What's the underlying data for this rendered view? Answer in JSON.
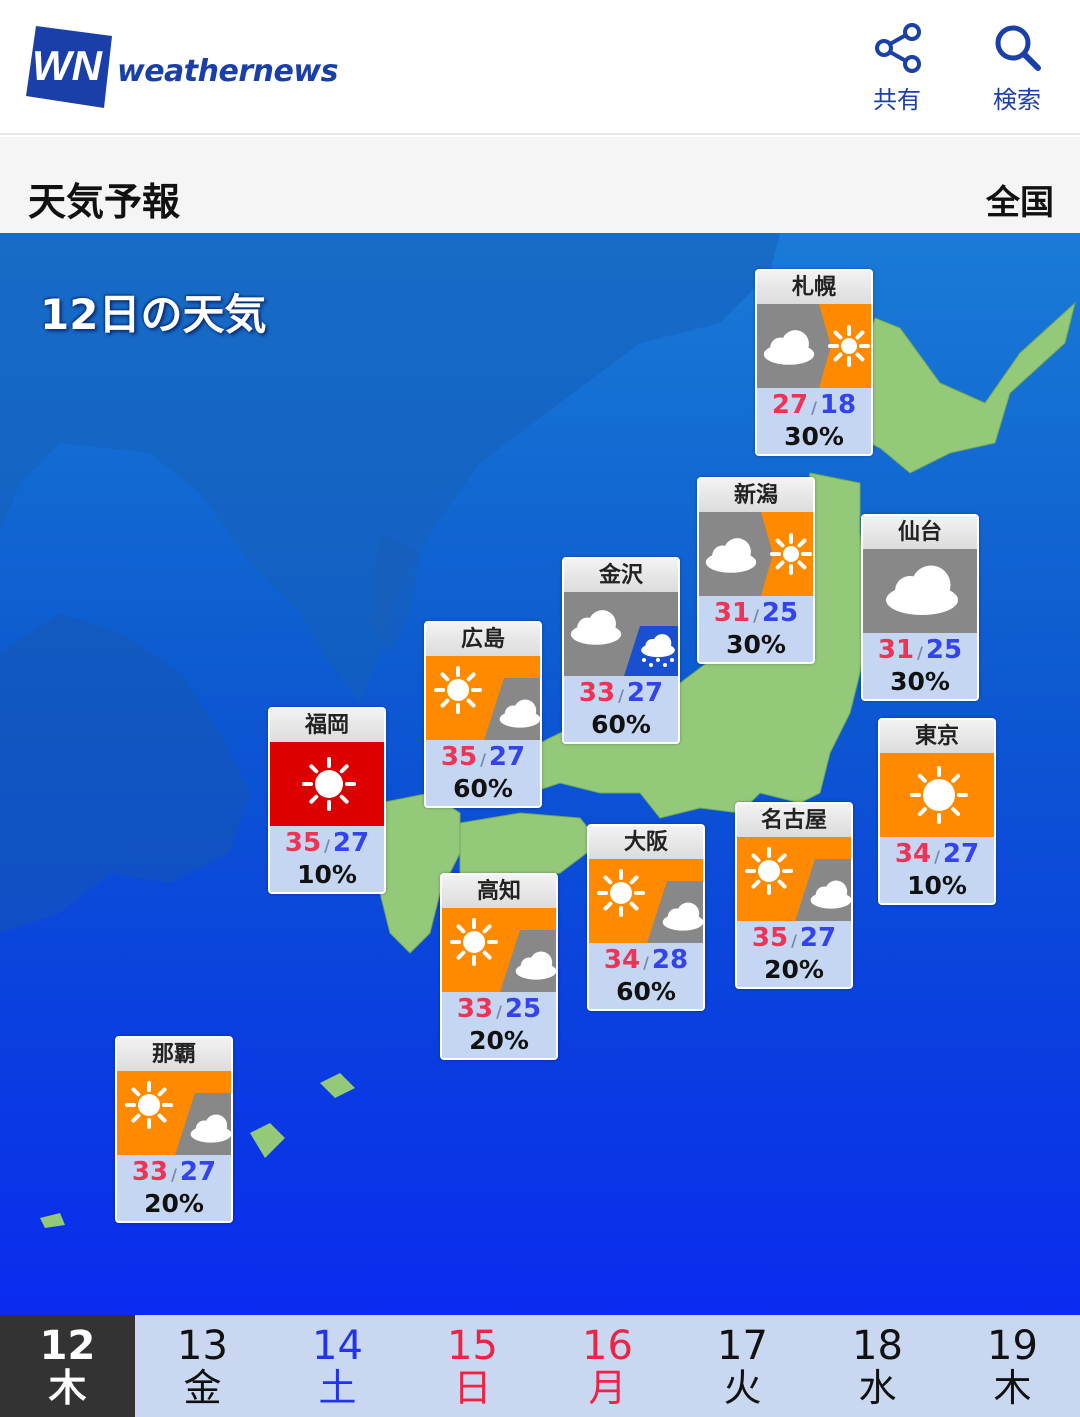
{
  "header": {
    "logo_text": "weathernews",
    "share_label": "共有",
    "search_label": "検索"
  },
  "subheader": {
    "title": "天気予報",
    "region": "全国"
  },
  "map": {
    "title": "12日の天気",
    "cities": [
      {
        "name": "札幌",
        "hi": "27",
        "lo": "18",
        "pop": "30%",
        "weather": "cloudy-then-sunny"
      },
      {
        "name": "新潟",
        "hi": "31",
        "lo": "25",
        "pop": "30%",
        "weather": "cloudy-then-sunny"
      },
      {
        "name": "仙台",
        "hi": "31",
        "lo": "25",
        "pop": "30%",
        "weather": "cloudy"
      },
      {
        "name": "金沢",
        "hi": "33",
        "lo": "27",
        "pop": "60%",
        "weather": "cloudy-with-rain"
      },
      {
        "name": "広島",
        "hi": "35",
        "lo": "27",
        "pop": "60%",
        "weather": "sunny-with-clouds"
      },
      {
        "name": "福岡",
        "hi": "35",
        "lo": "27",
        "pop": "10%",
        "weather": "hot-sunny"
      },
      {
        "name": "東京",
        "hi": "34",
        "lo": "27",
        "pop": "10%",
        "weather": "sunny"
      },
      {
        "name": "名古屋",
        "hi": "35",
        "lo": "27",
        "pop": "20%",
        "weather": "sunny-with-clouds"
      },
      {
        "name": "大阪",
        "hi": "34",
        "lo": "28",
        "pop": "60%",
        "weather": "sunny-with-clouds"
      },
      {
        "name": "高知",
        "hi": "33",
        "lo": "25",
        "pop": "20%",
        "weather": "sunny-with-clouds"
      },
      {
        "name": "那覇",
        "hi": "33",
        "lo": "27",
        "pop": "20%",
        "weather": "sunny-with-clouds"
      }
    ]
  },
  "days": [
    {
      "num": "12",
      "wd": "木",
      "color": "#ffffff",
      "selected": true
    },
    {
      "num": "13",
      "wd": "金",
      "color": "#111111"
    },
    {
      "num": "14",
      "wd": "土",
      "color": "#2233ee"
    },
    {
      "num": "15",
      "wd": "日",
      "color": "#ee2244"
    },
    {
      "num": "16",
      "wd": "月",
      "color": "#ee2244"
    },
    {
      "num": "17",
      "wd": "火",
      "color": "#111111"
    },
    {
      "num": "18",
      "wd": "水",
      "color": "#111111"
    },
    {
      "num": "19",
      "wd": "木",
      "color": "#111111"
    }
  ],
  "colors": {
    "sunny": "#ff8a00",
    "cloudy": "#888888",
    "hot": "#dd0000",
    "brand": "#1a3fa8"
  }
}
